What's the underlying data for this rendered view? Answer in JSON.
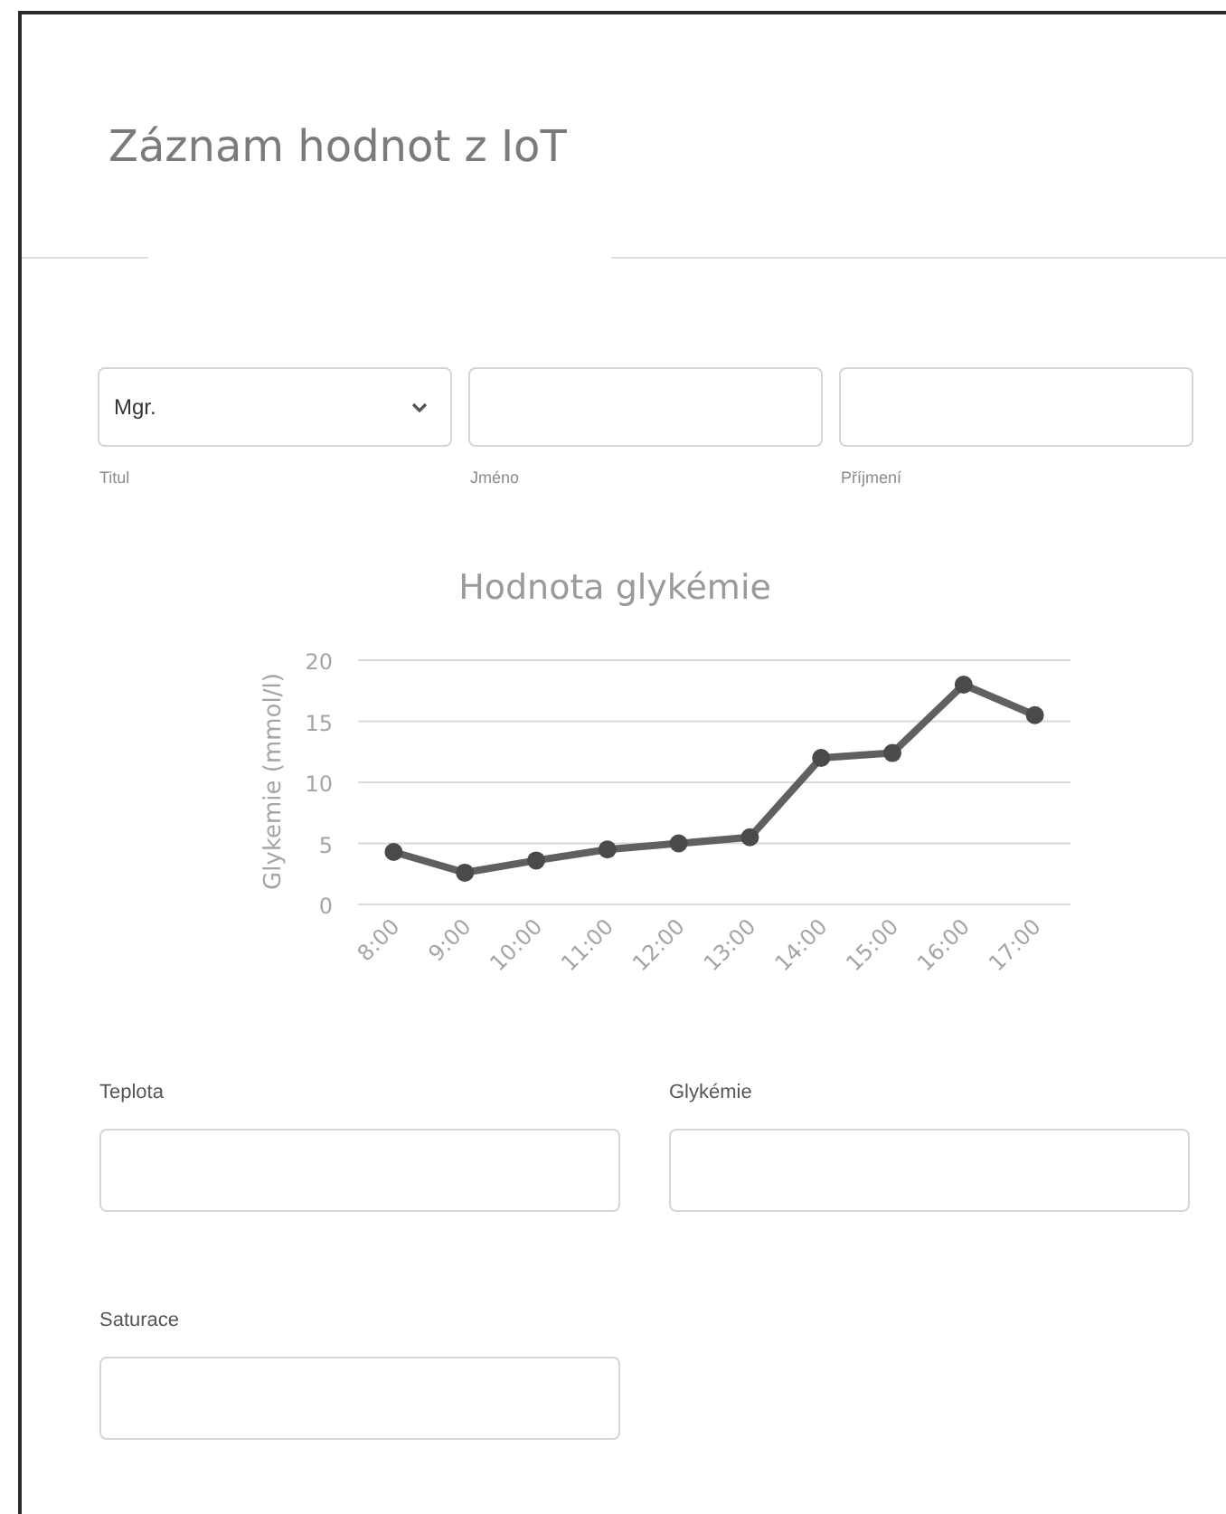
{
  "title": "Záznam hodnot z IoT",
  "name_fields": [
    {
      "kind": "select",
      "label": "Titul",
      "value": "Mgr."
    },
    {
      "kind": "text",
      "label": "Jméno"
    },
    {
      "kind": "text",
      "label": "Příjmení"
    }
  ],
  "chart": {
    "chart_data": {
      "type": "line",
      "title": "Hodnota glykémie",
      "ylabel": "Glykemie (mmol/l)",
      "categories": [
        "8:00",
        "9:00",
        "10:00",
        "11:00",
        "12:00",
        "13:00",
        "14:00",
        "15:00",
        "16:00",
        "17:00"
      ],
      "series": [
        {
          "color": "#606060",
          "marker": "circle",
          "values": [
            4.3,
            2.6,
            3.6,
            4.5,
            5,
            5.5,
            12,
            12.4,
            18,
            15.5
          ]
        }
      ],
      "grid": true,
      "ylim": [
        0,
        20
      ],
      "yticks": [
        0,
        5,
        10,
        15,
        20
      ]
    }
  },
  "measure_fields": [
    {
      "label": "Teplota"
    },
    {
      "label": "Glykémie"
    },
    {
      "label": "Saturace"
    }
  ]
}
